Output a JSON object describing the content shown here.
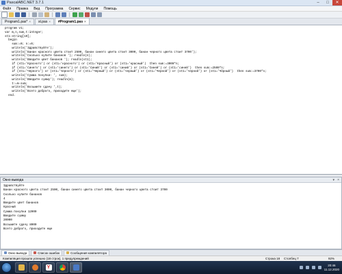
{
  "window": {
    "title": "PascalABC.NET 3.7.1"
  },
  "menu": [
    "Файл",
    "Правка",
    "Вид",
    "Программа",
    "Сервис",
    "Модули",
    "Помощь"
  ],
  "toolbar": {
    "icons": [
      "new-file-icon",
      "open-file-icon",
      "save-icon",
      "save-all-icon",
      "cut-icon",
      "copy-icon",
      "paste-icon",
      "undo-icon",
      "redo-icon",
      "run-icon",
      "debug-icon",
      "stop-icon",
      "step-icon",
      "format-icon"
    ]
  },
  "tabs": [
    {
      "label": "Program1.pas*",
      "active": false
    },
    {
      "label": "st.pas",
      "active": false
    },
    {
      "label": "#Program1.pas",
      "active": true
    }
  ],
  "editor": {
    "lines": [
      "program v1;",
      "var m,n,sum,t:integer;",
      "st1:string[10];",
      "  begin",
      "    sum:=0; n:=0;",
      "    writeln('Здравствуйте');",
      "    writeln('Банан красного цвета стоит 2500, банан синего цвета стоит 3000, банан черного цвета стоит 3700');",
      "    writeln('Сколько купите бананов '); readln(n);",
      "    writeln('Введите цвет бананов '); readln(st1);",
      "    if (st1='Красного') or (st1='красного') or (st1='Красный') or (st1='красный')  then sum:=3000*n;",
      "    if (st1='Синего') or (st1='синего') or (st1='Синий') or (st1='синий') or (st1='Синей') or (st1='синей')  then sum:=2500*n;",
      "    if (st1='Черного') or (st1='черного') or (st1='Черный') or (st1='черный') or (st1='Черной') or (st1='черной') or (st1='Чёрный')  then sum:=3700*n;",
      "    writeln('Сумма покупки: ', sum);",
      "    writeln('Введите сумму'); readln(m);",
      "    t:=m-sum;",
      "    writeln('Возьмите сдачу ',t);",
      "    writeln('Всего доброго, приходите еще');",
      "  end."
    ]
  },
  "output": {
    "title": "Окно вывода",
    "lines": [
      "Здравствуйте",
      "Банан красного цвета стоит 2500, банан синего цвета стоит 3000, банан черного цвета стоит 3700",
      "Сколько купите бананов",
      "4",
      "Введите цвет бананов",
      "Красный",
      "Сумма покупки 12000",
      "Введите сумму",
      "20000",
      "Возьмите сдачу 8000",
      "Всего доброго, приходите еще"
    ]
  },
  "bottom_tabs": [
    "Окно вывода",
    "Список ошибок",
    "Сообщения компилятора"
  ],
  "status": {
    "message": "Компиляция прошла успешно (18 строк), 1 предупреждений",
    "line": "Строка 18",
    "column": "Столбец 7",
    "zoom": "92%"
  },
  "taskbar": {
    "apps": [
      "explorer-icon",
      "media-player-icon",
      "yandex-browser-icon",
      "chrome-icon",
      "pascal-abc-icon"
    ],
    "clock_time": "20:46",
    "clock_date": "11.12.2020"
  },
  "colors": {
    "titlebar": "#dbe6f3",
    "close": "#c8473b",
    "taskbar": "#1a2a44"
  }
}
